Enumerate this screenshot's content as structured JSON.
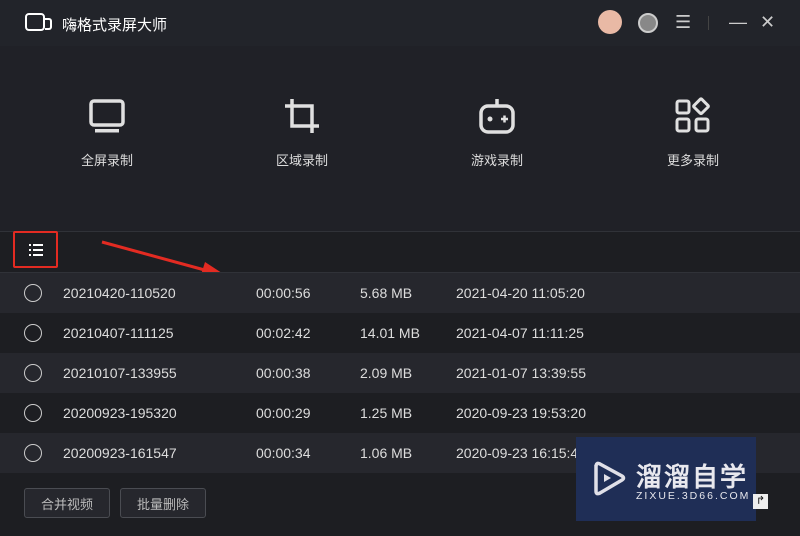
{
  "app": {
    "title": "嗨格式录屏大师"
  },
  "titlebar": {
    "icons": [
      "avatar-icon",
      "support-icon",
      "menu-icon",
      "minimize-icon",
      "close-icon"
    ]
  },
  "modes": [
    {
      "label": "全屏录制",
      "icon": "monitor-icon"
    },
    {
      "label": "区域录制",
      "icon": "crop-icon"
    },
    {
      "label": "游戏录制",
      "icon": "gamepad-icon"
    },
    {
      "label": "更多录制",
      "icon": "grid-icon"
    }
  ],
  "recordings": [
    {
      "name": "20210420-110520",
      "duration": "00:00:56",
      "size": "5.68 MB",
      "date": "2021-04-20 11:05:20"
    },
    {
      "name": "20210407-111125",
      "duration": "00:02:42",
      "size": "14.01 MB",
      "date": "2021-04-07 11:11:25"
    },
    {
      "name": "20210107-133955",
      "duration": "00:00:38",
      "size": "2.09 MB",
      "date": "2021-01-07 13:39:55"
    },
    {
      "name": "20200923-195320",
      "duration": "00:00:29",
      "size": "1.25 MB",
      "date": "2020-09-23 19:53:20"
    },
    {
      "name": "20200923-161547",
      "duration": "00:00:34",
      "size": "1.06 MB",
      "date": "2020-09-23 16:15:47"
    }
  ],
  "footer": {
    "merge": "合并视频",
    "batch_delete": "批量删除"
  },
  "watermark": {
    "brand": "溜溜自学",
    "url": "ZIXUE.3D66.COM"
  }
}
